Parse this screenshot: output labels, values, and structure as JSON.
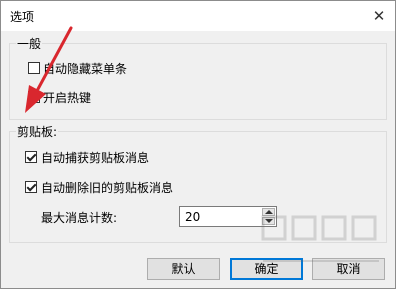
{
  "dialog": {
    "title": "选项"
  },
  "general": {
    "label": "一般",
    "auto_hide_menu": "自动隐藏菜单条",
    "enable_hotkeys": "开启热键"
  },
  "clipboard": {
    "label": "剪贴板:",
    "auto_capture": "自动捕获剪贴板消息",
    "auto_delete_old": "自动删除旧的剪贴板消息",
    "max_count_label": "最大消息计数:",
    "max_count_value": "20"
  },
  "buttons": {
    "default": "默认",
    "ok": "确定",
    "cancel": "取消"
  },
  "icons": {
    "close": "close-icon",
    "spin_up": "arrow-up-icon",
    "spin_down": "arrow-down-icon"
  },
  "colors": {
    "accent": "#0078d7",
    "arrow": "#d9272e"
  }
}
